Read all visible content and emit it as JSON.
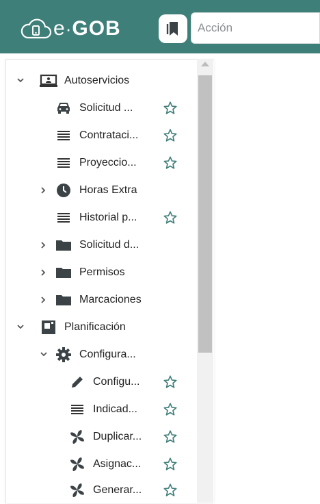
{
  "header": {
    "brand_e": "e",
    "brand_dot": "·",
    "brand_gob": "GOB",
    "search_placeholder": "Acción",
    "icons": [
      "cloud-logo-icon",
      "bookmark-icon"
    ],
    "colors": {
      "header_bg": "#3f7f79",
      "icon_dark": "#3c4347"
    }
  },
  "menu": {
    "items": [
      {
        "label": "Autoservicios",
        "icon": "monitor-icon",
        "expander": "expanded"
      },
      {
        "label": "Solicitud ...",
        "icon": "car-icon",
        "favorite": true
      },
      {
        "label": "Contrataci...",
        "icon": "list-icon",
        "favorite": true
      },
      {
        "label": "Proyeccio...",
        "icon": "list-icon",
        "favorite": true
      },
      {
        "label": "Horas Extra",
        "icon": "clock-icon",
        "expander": "collapsed"
      },
      {
        "label": "Historial p...",
        "icon": "list-icon",
        "favorite": true
      },
      {
        "label": "Solicitud d...",
        "icon": "folder-icon",
        "expander": "collapsed"
      },
      {
        "label": "Permisos",
        "icon": "folder-icon",
        "expander": "collapsed"
      },
      {
        "label": "Marcaciones",
        "icon": "folder-icon",
        "expander": "collapsed"
      },
      {
        "label": "Planificación",
        "icon": "planner-icon",
        "expander": "expanded"
      },
      {
        "label": "Configura...",
        "icon": "gear-icon",
        "expander": "expanded"
      },
      {
        "label": "Configu...",
        "icon": "pencil-icon",
        "favorite": true
      },
      {
        "label": "Indicad...",
        "icon": "list-icon",
        "favorite": true
      },
      {
        "label": "Duplicar...",
        "icon": "pinwheel-icon",
        "favorite": true
      },
      {
        "label": "Asignac...",
        "icon": "pinwheel-icon",
        "favorite": true
      },
      {
        "label": "Generar...",
        "icon": "pinwheel-icon",
        "favorite": true
      }
    ]
  }
}
